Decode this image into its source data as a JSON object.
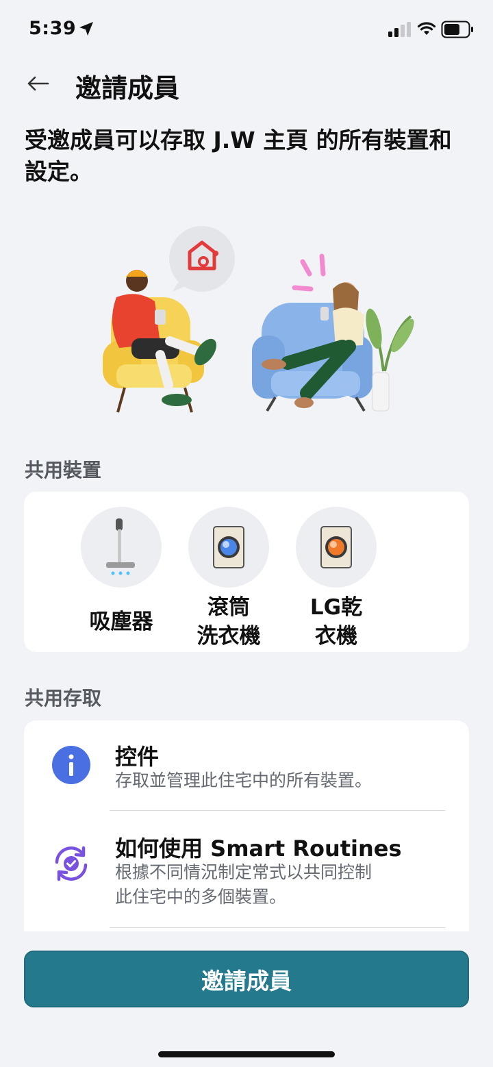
{
  "status_bar": {
    "time": "5:39"
  },
  "header": {
    "title": "邀請成員",
    "description": "受邀成員可以存取 J.W 主頁 的所有裝置和設定。"
  },
  "shared_devices": {
    "title": "共用裝置",
    "items": [
      {
        "label": "吸塵器",
        "icon": "vacuum-icon"
      },
      {
        "label": "滾筒\n洗衣機",
        "icon": "washer-icon"
      },
      {
        "label": "LG乾\n衣機",
        "icon": "dryer-icon"
      }
    ]
  },
  "shared_access": {
    "title": "共用存取",
    "items": [
      {
        "title": "控件",
        "description": "存取並管理此住宅中的所有裝置。",
        "icon": "info-icon",
        "color": "#4a6fe3"
      },
      {
        "title": "如何使用 Smart Routines",
        "description": "根據不同情況制定常式以共同控制\n此住宅中的多個裝置。",
        "icon": "routine-icon",
        "color": "#7a52e0"
      }
    ]
  },
  "invite_button": {
    "label": "邀請成員",
    "color": "#247a8c"
  }
}
